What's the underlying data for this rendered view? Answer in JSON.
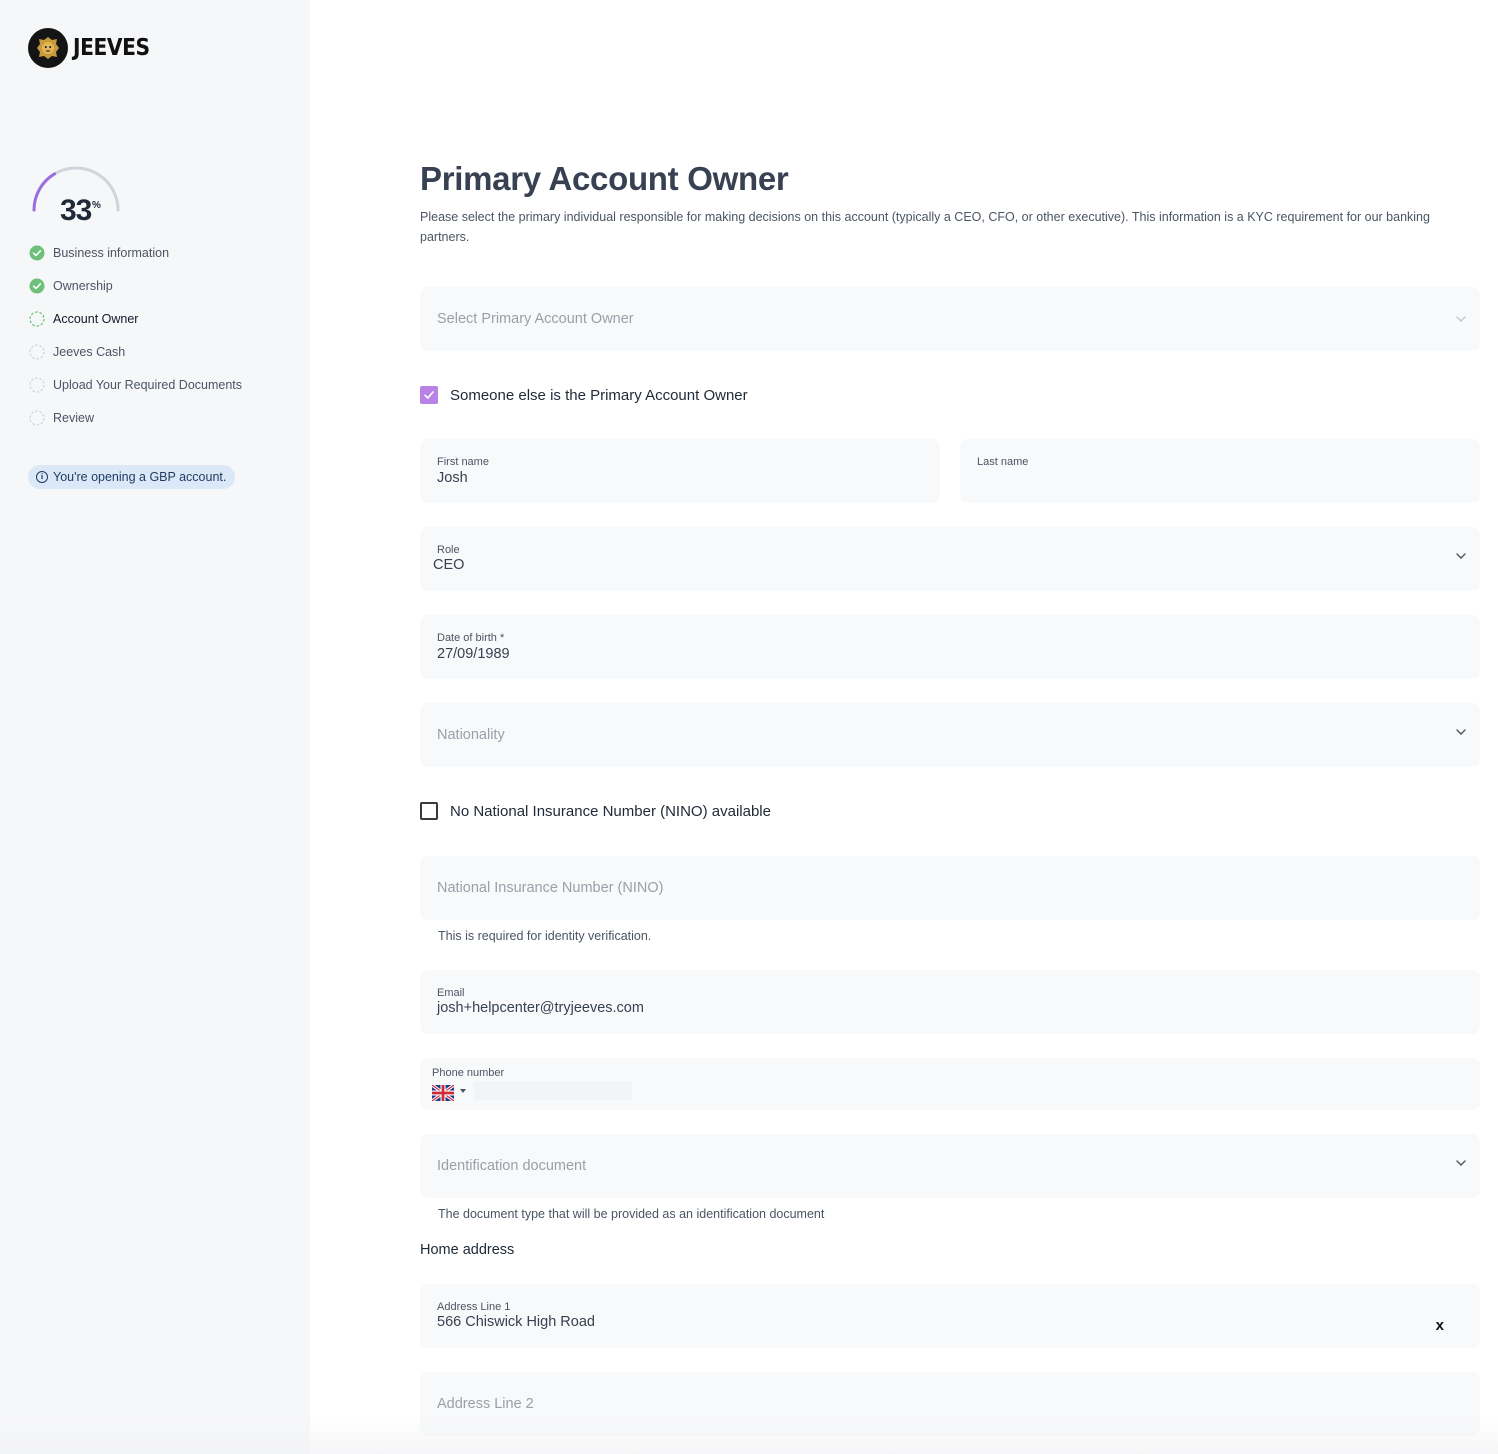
{
  "brand": {
    "name": "JEEVES",
    "logo_icon": "lion-head-icon"
  },
  "progress": {
    "value": 33,
    "percent_symbol": "%",
    "fraction": 0.33
  },
  "steps": [
    {
      "label": "Business information",
      "status": "complete"
    },
    {
      "label": "Ownership",
      "status": "complete"
    },
    {
      "label": "Account Owner",
      "status": "current"
    },
    {
      "label": "Jeeves Cash",
      "status": "pending"
    },
    {
      "label": "Upload Your Required Documents",
      "status": "pending"
    },
    {
      "label": "Review",
      "status": "pending"
    }
  ],
  "notice": {
    "icon": "info-icon",
    "text": "You're opening a GBP account."
  },
  "page": {
    "title": "Primary Account Owner",
    "description": "Please select the primary individual responsible for making decisions on this account (typically a CEO, CFO, or other executive). This information is a KYC requirement for our banking partners."
  },
  "form": {
    "owner_select": {
      "placeholder": "Select Primary Account Owner"
    },
    "someone_else": {
      "label": "Someone else is the Primary Account Owner",
      "checked": true
    },
    "first_name": {
      "label": "First name",
      "value": "Josh"
    },
    "last_name": {
      "label": "Last name",
      "value": ""
    },
    "role": {
      "label": "Role",
      "value": "CEO"
    },
    "dob": {
      "label": "Date of birth *",
      "value": "27/09/1989"
    },
    "nationality": {
      "placeholder": "Nationality"
    },
    "no_nino": {
      "label": "No National Insurance Number (NINO) available",
      "checked": false
    },
    "nino": {
      "placeholder": "National Insurance Number (NINO)",
      "helper": "This is required for identity verification."
    },
    "email": {
      "label": "Email",
      "value": "josh+helpcenter@tryjeeves.com"
    },
    "phone": {
      "label": "Phone number",
      "country_flag": "uk-flag-icon",
      "value": ""
    },
    "id_document": {
      "placeholder": "Identification document",
      "helper": "The document type that will be provided as an identification document"
    },
    "home_address": {
      "section_label": "Home address",
      "line1": {
        "label": "Address Line 1",
        "value": "566 Chiswick High Road",
        "clear": "x"
      },
      "line2": {
        "placeholder": "Address Line 2"
      }
    }
  },
  "colors": {
    "accent": "#b982e6",
    "success": "#6cc07a",
    "sidebar_bg": "#f6f7f9",
    "field_bg": "#f8f9fb"
  }
}
